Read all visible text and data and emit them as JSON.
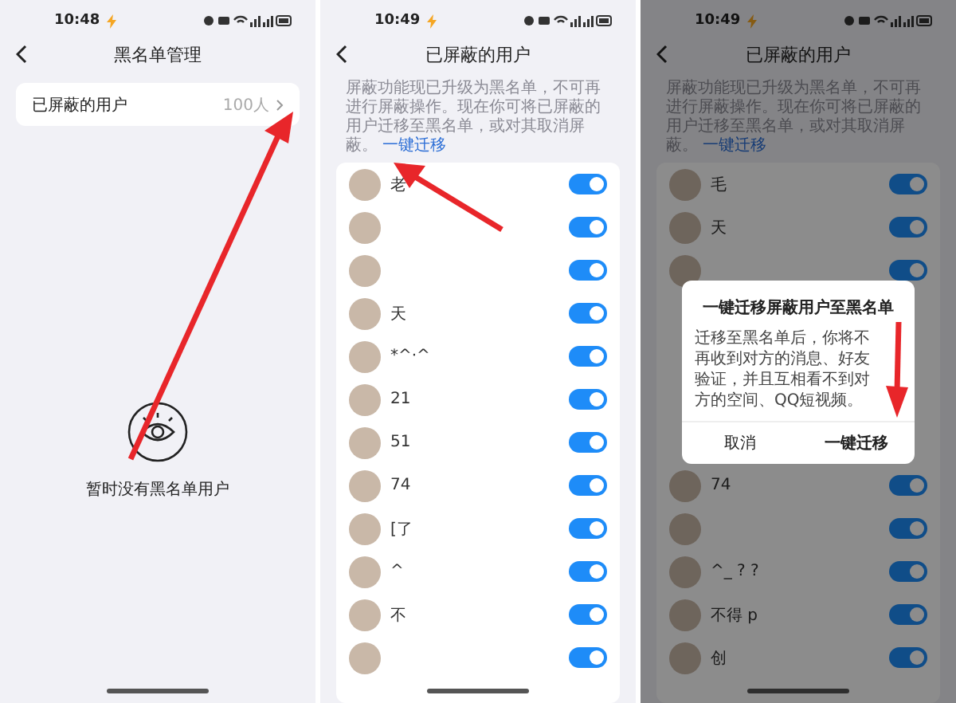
{
  "screens": [
    {
      "kind": "blacklist",
      "status_bar": {
        "time": "10:48"
      },
      "header": {
        "title": "黑名单管理"
      },
      "menu_item": {
        "label": "已屏蔽的用户",
        "value": "100人"
      },
      "empty_state": {
        "text": "暂时没有黑名单用户"
      }
    },
    {
      "kind": "blocked_list",
      "status_bar": {
        "time": "10:49"
      },
      "header": {
        "title": "已屏蔽的用户"
      },
      "notice": {
        "text": "屏蔽功能现已升级为黑名单，不可再进行屏蔽操作。现在你可将已屏蔽的用户迁移至黑名单，或对其取消屏蔽。",
        "link": "一键迁移"
      },
      "rows": [
        {
          "name": "老",
          "on": true
        },
        {
          "on": true
        },
        {
          "on": true
        },
        {
          "name": "天",
          "on": true
        },
        {
          "name": "*^·^",
          "on": true
        },
        {
          "name": "21",
          "on": true
        },
        {
          "name": "51",
          "on": true
        },
        {
          "name": "74",
          "on": true
        },
        {
          "name": "[了",
          "on": true
        },
        {
          "name": "^",
          "on": true
        },
        {
          "name": "不",
          "on": true
        },
        {
          "on": true
        }
      ]
    },
    {
      "kind": "blocked_list_dialog",
      "status_bar": {
        "time": "10:49"
      },
      "header": {
        "title": "已屏蔽的用户"
      },
      "notice": {
        "text": "屏蔽功能现已升级为黑名单，不可再进行屏蔽操作。现在你可将已屏蔽的用户迁移至黑名单，或对其取消屏蔽。",
        "link": "一键迁移"
      },
      "rows_above": [
        {
          "name": "毛",
          "on": true
        },
        {
          "name": "天",
          "on": true
        },
        {
          "on": true
        }
      ],
      "rows_below": [
        {
          "name": "74",
          "on": true
        },
        {
          "on": true
        },
        {
          "name": "^_ ? ?",
          "on": true
        },
        {
          "name": "不得 p",
          "on": true
        },
        {
          "name": "创",
          "on": true
        }
      ],
      "dialog": {
        "title": "一键迁移屏蔽用户至黑名单",
        "body": "迁移至黑名单后，你将不再收到对方的消息、好友验证，并且互相看不到对方的空间、QQ短视频。",
        "buttons": [
          {
            "label": "取消",
            "kind": "cancel"
          },
          {
            "label": "一键迁移",
            "kind": "confirm"
          }
        ]
      }
    }
  ]
}
